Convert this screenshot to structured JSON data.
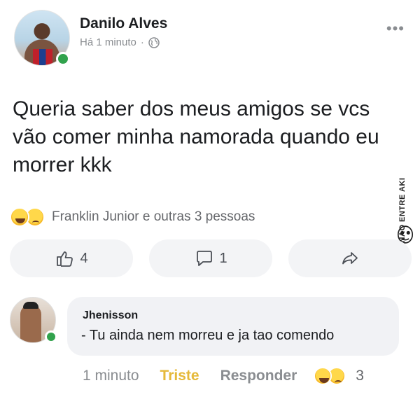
{
  "post": {
    "author": "Danilo Alves",
    "time": "Há 1 minuto",
    "separator": "·",
    "more_menu": "•••",
    "text": "Queria saber dos meus amigos se vcs vão comer minha namorada quando eu morrer kkk"
  },
  "reactions": {
    "icons": [
      "haha-emoji",
      "sad-emoji"
    ],
    "summary": "Franklin Junior e outras 3 pessoas"
  },
  "actions": {
    "like_count": "4",
    "comment_count": "1"
  },
  "watermark": {
    "text": "NÃO ENTRE AKI"
  },
  "comment": {
    "author": "Jhenisson",
    "text": "- Tu ainda nem morreu e ja tao comendo",
    "time": "1 minuto",
    "reaction_label": "Triste",
    "reply_label": "Responder",
    "reaction_count": "3"
  },
  "colors": {
    "online": "#31a24c",
    "sad_reaction": "#e5b93a",
    "muted": "#8a8d91"
  }
}
